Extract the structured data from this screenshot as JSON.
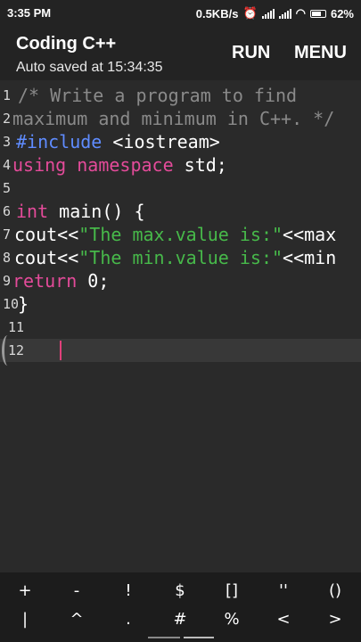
{
  "status": {
    "time": "3:35 PM",
    "net_speed": "0.5KB/s",
    "battery": "62%"
  },
  "app": {
    "title": "Coding C++",
    "subtitle": "Auto saved at 15:34:35",
    "run_label": "RUN",
    "menu_label": "MENU"
  },
  "editor": {
    "line_numbers": [
      "1",
      "2",
      "3",
      "4",
      "5",
      "6",
      "7",
      "8",
      "9",
      "10",
      "11",
      "12"
    ],
    "l1": "/* Write a program to find",
    "l2": "maximum and minimum in C++. */",
    "l3_pp": "#include",
    "l3_rest": " <iostream>",
    "l4_kw1": "using",
    "l4_kw2": "namespace",
    "l4_rest": " std;",
    "l6_kw": "int",
    "l6_rest": " main() {",
    "l7_a": "cout<<",
    "l7_str": "\"The max.value is:\"",
    "l7_b": "<<max",
    "l8_a": "cout<<",
    "l8_str": "\"The min.value is:\"",
    "l8_b": "<<min",
    "l9_kw": "return",
    "l9_rest": " 0;",
    "l10": "}"
  },
  "symbols": {
    "row1": [
      "+",
      "-",
      "!",
      "$",
      "[]",
      "''",
      "()"
    ],
    "row2": [
      "|",
      "^",
      ".",
      "#",
      "%",
      "<",
      ">"
    ]
  }
}
